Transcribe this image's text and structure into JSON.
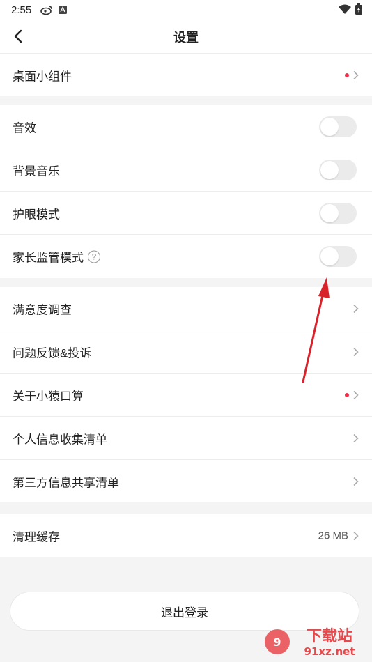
{
  "status_bar": {
    "time": "2:55"
  },
  "header": {
    "title": "设置"
  },
  "group1": {
    "widget_label": "桌面小组件"
  },
  "toggles": {
    "sound_label": "音效",
    "bgm_label": "背景音乐",
    "eye_label": "护眼模式",
    "parent_label": "家长监管模式",
    "help_glyph": "?",
    "sound_on": false,
    "bgm_on": false,
    "eye_on": false,
    "parent_on": false
  },
  "menu": {
    "survey_label": "满意度调查",
    "feedback_label": "问题反馈&投诉",
    "about_label": "关于小猿口算",
    "personal_info_label": "个人信息收集清单",
    "third_party_label": "第三方信息共享清单"
  },
  "cache": {
    "label": "清理缓存",
    "value": "26 MB"
  },
  "logout": {
    "label": "退出登录"
  },
  "watermark": {
    "logo_text": "下载站",
    "url_text": "91xz.net"
  },
  "colors": {
    "accent_dot": "#f0304a",
    "annotation_arrow": "#d9232b"
  }
}
